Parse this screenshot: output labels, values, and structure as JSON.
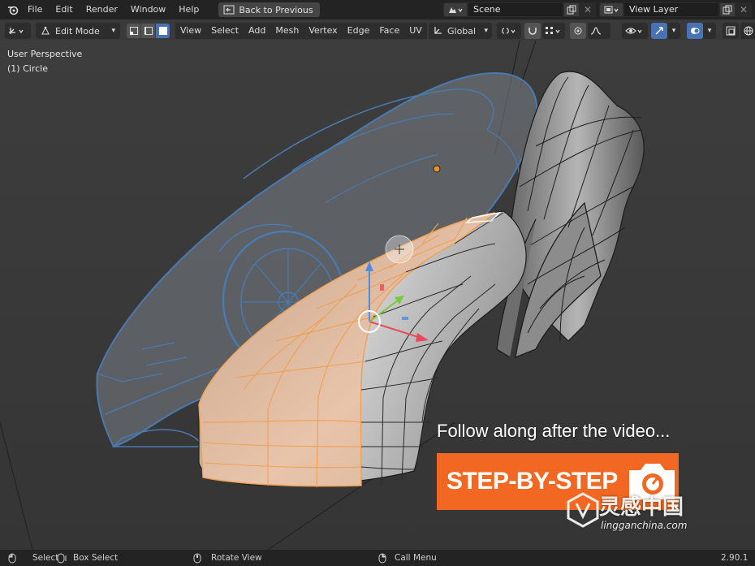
{
  "menubar": {
    "items": [
      "File",
      "Edit",
      "Render",
      "Window",
      "Help"
    ],
    "back_button": "Back to Previous",
    "scene": "Scene",
    "view_layer": "View Layer"
  },
  "viewport_header": {
    "mode": "Edit Mode",
    "menus": [
      "View",
      "Select",
      "Add",
      "Mesh",
      "Vertex",
      "Edge",
      "Face",
      "UV"
    ],
    "orientation": "Global"
  },
  "viewport": {
    "perspective_label": "User Perspective",
    "object_label": "(1) Circle"
  },
  "promo": {
    "caption": "Follow along after the video...",
    "badge": "STEP-BY-STEP"
  },
  "watermark": {
    "name": "灵感中国",
    "url": "lingganchina.com"
  },
  "statusbar": {
    "select": "Select",
    "box_select": "Box Select",
    "rotate_view": "Rotate View",
    "call_menu": "Call Menu",
    "version": "2.90.1"
  },
  "colors": {
    "selection": "#f0a050",
    "promo": "#f26822",
    "blueprint": "#4a7ab0",
    "background": "#3a3a3a"
  }
}
